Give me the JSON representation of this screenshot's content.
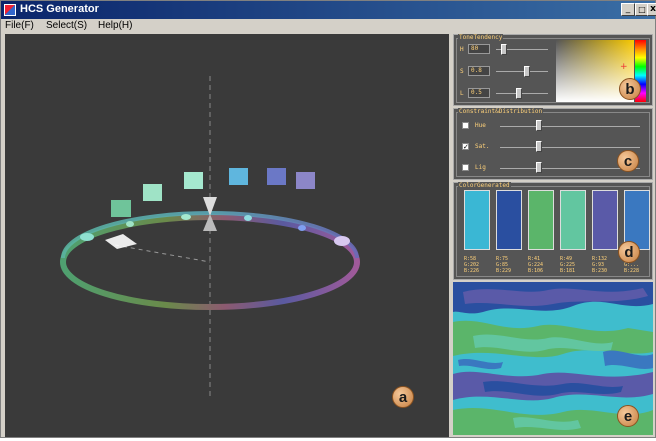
{
  "app": {
    "title": "HCS Generator"
  },
  "window_buttons": {
    "minimize": "_",
    "maximize": "□",
    "close": "x"
  },
  "menu": [
    "File(F)",
    "Select(S)",
    "Help(H)"
  ],
  "badges": {
    "a": "a",
    "b": "b",
    "c": "c",
    "d": "d",
    "e": "e"
  },
  "tone_panel": {
    "title": "ToneTendency",
    "fields": [
      {
        "label": "H",
        "value": "80"
      },
      {
        "label": "S",
        "value": "0.8"
      },
      {
        "label": "L",
        "value": "0.5"
      }
    ],
    "slider_levels": [
      0.15,
      0.6,
      0.45
    ]
  },
  "constraint_panel": {
    "title": "Constraint&Distribution",
    "rows": [
      {
        "label": "Hue",
        "checked": false,
        "check_mark": "",
        "level": 0.28
      },
      {
        "label": "Sat.",
        "checked": true,
        "check_mark": "✓",
        "level": 0.28
      },
      {
        "label": "Lig",
        "checked": false,
        "check_mark": "",
        "level": 0.28
      }
    ]
  },
  "colors_panel": {
    "title": "ColorGenerated",
    "colors": [
      {
        "hex": "#3ab7d4",
        "text": "R:58\nG:202\nB:226"
      },
      {
        "hex": "#2a4fa0",
        "text": "R:75\nG:85\nB:229"
      },
      {
        "hex": "#5bb56a",
        "text": "R:41\nG:224\nB:106"
      },
      {
        "hex": "#62c6a0",
        "text": "R:49\nG:225\nB:181"
      },
      {
        "hex": "#5a5aa8",
        "text": "R:132\nG:93\nB:230"
      },
      {
        "hex": "#3a78c0",
        "text": "R:40\nG:...\nB:228"
      }
    ]
  },
  "viewport_swatches": [
    "#6fc49a",
    "#9fe3c6",
    "#a5e8cf",
    "#5fb6de",
    "#6b78c6",
    "#8c86c8"
  ]
}
